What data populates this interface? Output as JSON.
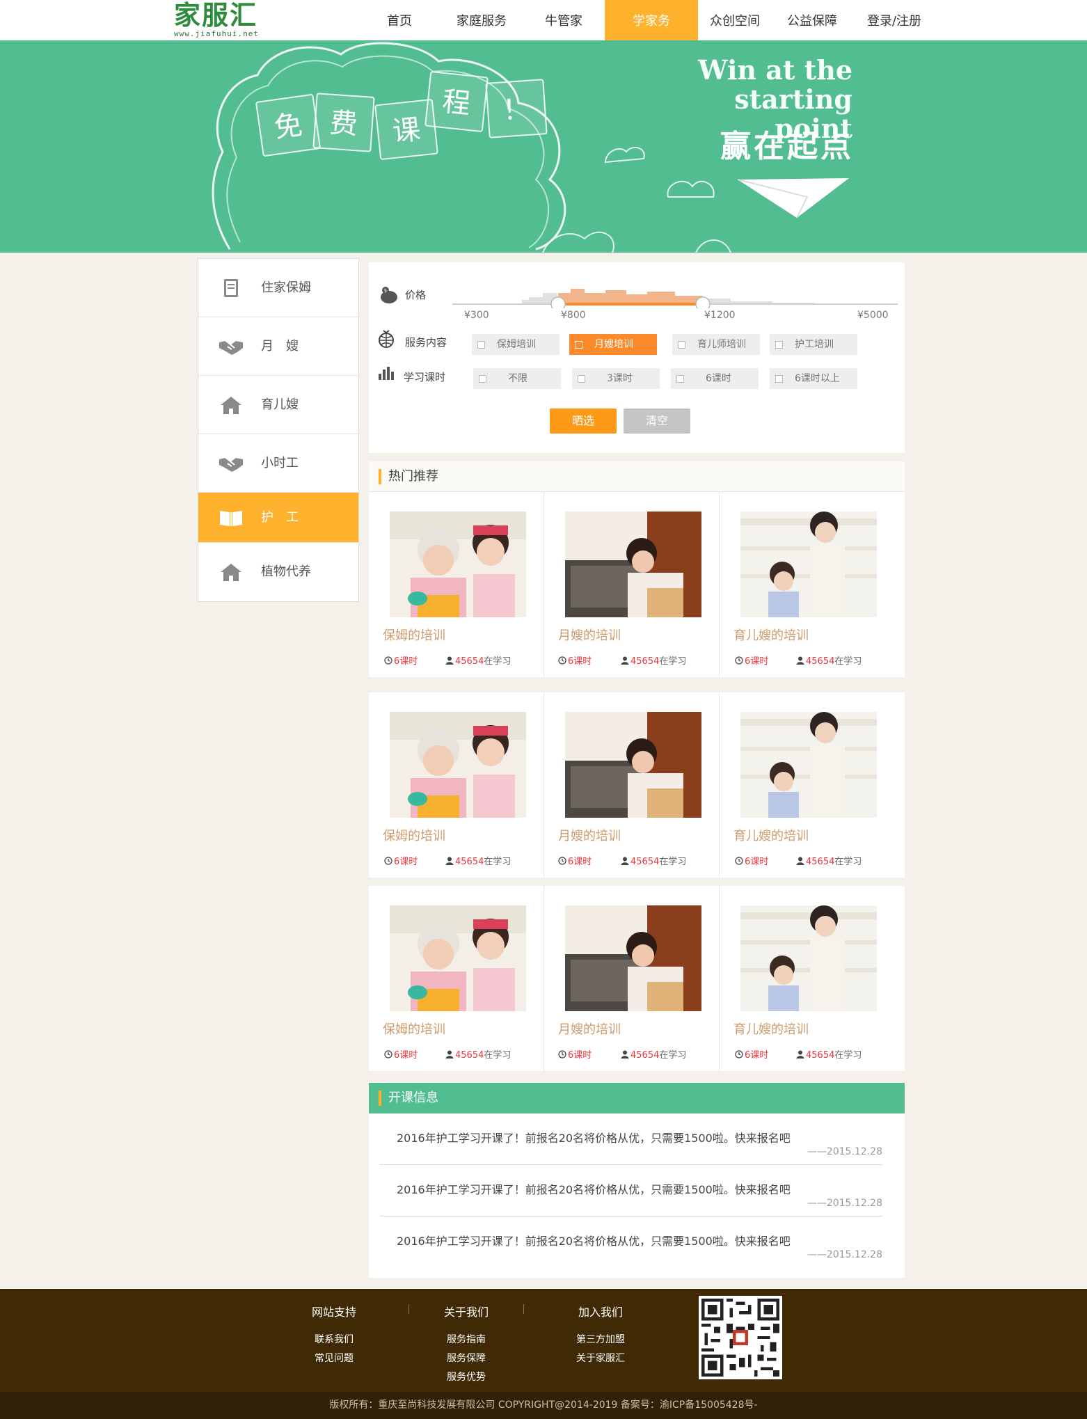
{
  "header": {
    "logo_text": "家服汇",
    "logo_url": "www.jiafuhui.net",
    "nav": [
      "首页",
      "家庭服务",
      "牛管家",
      "学家务",
      "众创空间",
      "公益保障",
      "登录/注册"
    ],
    "active_nav": 3
  },
  "banner": {
    "notes": [
      "免",
      "费",
      "课",
      "程",
      "！"
    ],
    "en_line1": "Win at the",
    "en_line2": "starting point",
    "cn": "赢在起点"
  },
  "sidebar": {
    "items": [
      {
        "label": "住家保姆",
        "icon": "book-icon"
      },
      {
        "label": "月　嫂",
        "icon": "handshake-icon"
      },
      {
        "label": "育儿嫂",
        "icon": "home-icon"
      },
      {
        "label": "小时工",
        "icon": "handshake-icon"
      },
      {
        "label": "护　工",
        "icon": "open-book-icon"
      },
      {
        "label": "植物代养",
        "icon": "home-icon"
      }
    ],
    "active_index": 4
  },
  "filter": {
    "price_label": "价格",
    "price_ticks": [
      "¥300",
      "¥800",
      "¥1200",
      "¥5000"
    ],
    "price_range": {
      "min": "¥800",
      "max": "¥1200"
    },
    "service_label": "服务内容",
    "service_options": [
      "保姆培训",
      "月嫂培训",
      "育儿师培训",
      "护工培训"
    ],
    "service_selected": 1,
    "hours_label": "学习课时",
    "hours_options": [
      "不限",
      "3课时",
      "6课时",
      "6课时以上"
    ],
    "submit": "晒选",
    "clear": "清空"
  },
  "hot": {
    "title": "热门推荐",
    "rows": [
      [
        {
          "title": "保姆的培训",
          "hours": "6课时",
          "count": "45654",
          "suffix": "在学习"
        },
        {
          "title": "月嫂的培训",
          "hours": "6课时",
          "count": "45654",
          "suffix": "在学习"
        },
        {
          "title": "育儿嫂的培训",
          "hours": "6课时",
          "count": "45654",
          "suffix": "在学习"
        }
      ],
      [
        {
          "title": "保姆的培训",
          "hours": "6课时",
          "count": "45654",
          "suffix": "在学习"
        },
        {
          "title": "月嫂的培训",
          "hours": "6课时",
          "count": "45654",
          "suffix": "在学习"
        },
        {
          "title": "育儿嫂的培训",
          "hours": "6课时",
          "count": "45654",
          "suffix": "在学习"
        }
      ],
      [
        {
          "title": "保姆的培训",
          "hours": "6课时",
          "count": "45654",
          "suffix": "在学习"
        },
        {
          "title": "月嫂的培训",
          "hours": "6课时",
          "count": "45654",
          "suffix": "在学习"
        },
        {
          "title": "育儿嫂的培训",
          "hours": "6课时",
          "count": "45654",
          "suffix": "在学习"
        }
      ]
    ]
  },
  "open_info": {
    "title": "开课信息",
    "items": [
      {
        "text": "2016年护工学习开课了！前报名20名将价格从优，只需要1500啦。快来报名吧",
        "date": "——2015.12.28"
      },
      {
        "text": "2016年护工学习开课了！前报名20名将价格从优，只需要1500啦。快来报名吧",
        "date": "——2015.12.28"
      },
      {
        "text": "2016年护工学习开课了！前报名20名将价格从优，只需要1500啦。快来报名吧",
        "date": "——2015.12.28"
      }
    ]
  },
  "footer": {
    "cols": [
      {
        "head": "网站支持",
        "links": [
          "联系我们",
          "常见问题"
        ]
      },
      {
        "head": "关于我们",
        "links": [
          "服务指南",
          "服务保障",
          "服务优势"
        ]
      },
      {
        "head": "加入我们",
        "links": [
          "第三方加盟",
          "关于家服汇"
        ]
      }
    ],
    "copyright": "版权所有：重庆至尚科技发展有限公司 COPYRIGHT@2014-2019 备案号：渝ICP备15005428号-"
  },
  "colors": {
    "accent": "#fdb12d",
    "green": "#52bd91",
    "brown": "#3f2a05",
    "orange": "#fd8a2a"
  }
}
